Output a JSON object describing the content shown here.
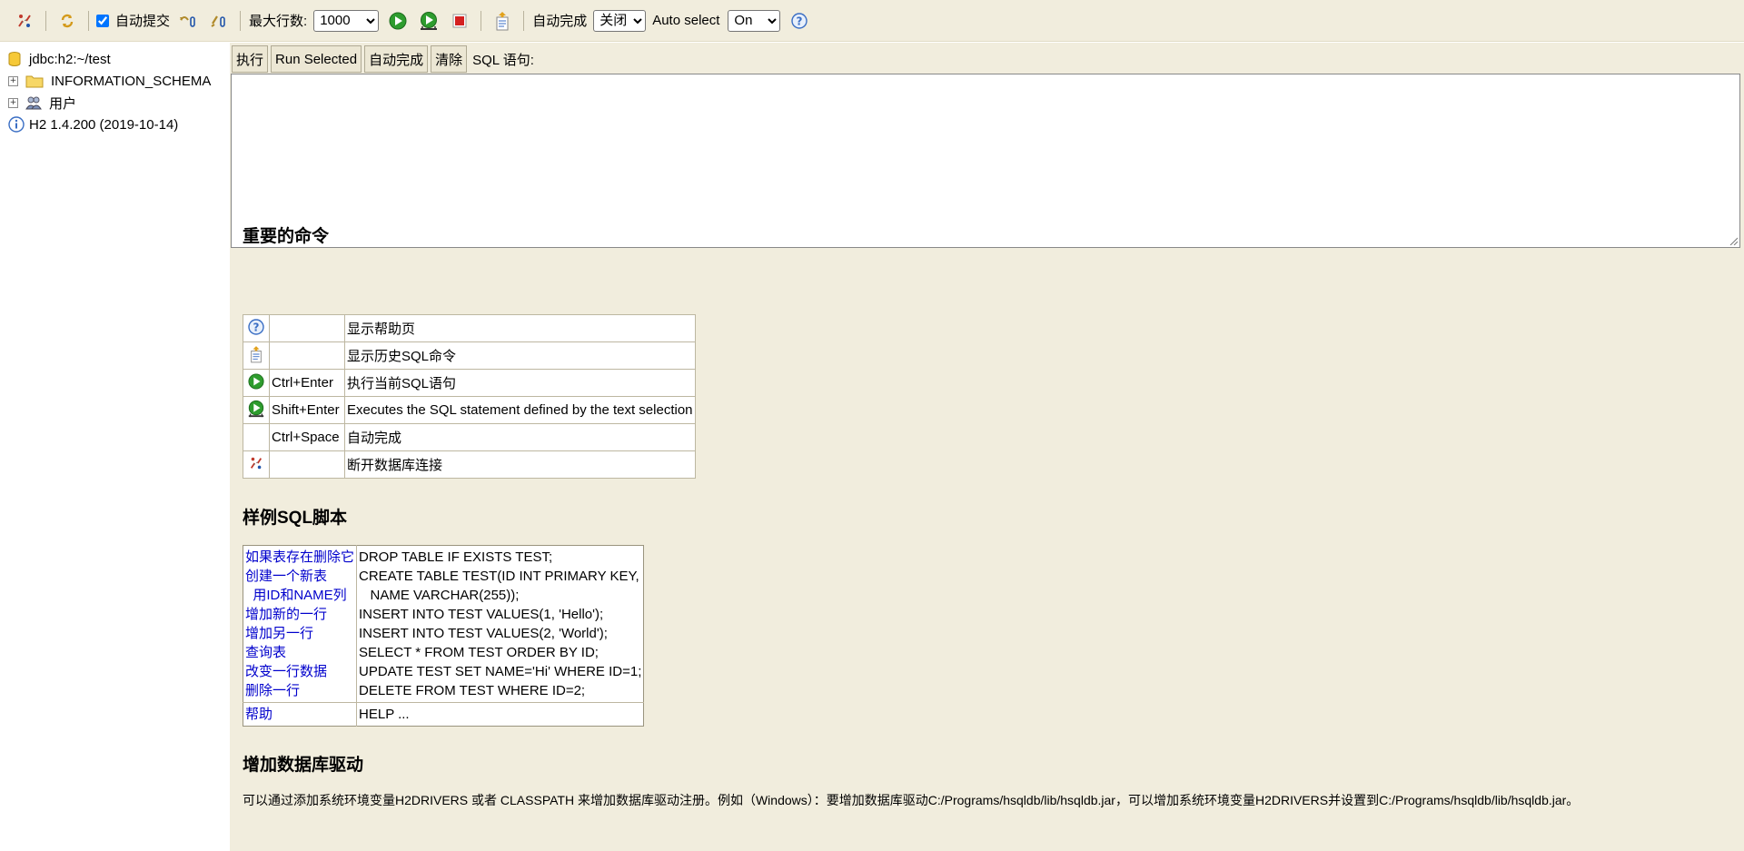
{
  "toolbar": {
    "autocommit_label": "自动提交",
    "autocommit_checked": true,
    "max_rows_label": "最大行数:",
    "max_rows_value": "1000",
    "autocomplete_label": "自动完成",
    "autocomplete_value": "关闭",
    "autoselect_label": "Auto select",
    "autoselect_value": "On",
    "icons": [
      "disconnect-icon",
      "refresh-icon",
      "rollback-icon",
      "commit-icon",
      "run-icon",
      "run-selected-icon",
      "stop-icon",
      "history-icon",
      "help-icon"
    ]
  },
  "tree": {
    "connection": "jdbc:h2:~/test",
    "schema": "INFORMATION_SCHEMA",
    "users": "用户",
    "version": "H2 1.4.200 (2019-10-14)",
    "expander_symbol": "+"
  },
  "editor": {
    "buttons": {
      "execute": "执行",
      "run_selected": "Run Selected",
      "autocomplete": "自动完成",
      "clear": "清除"
    },
    "sql_label": "SQL 语句:"
  },
  "important": {
    "title": "重要的命令",
    "rows": [
      {
        "icon": "help-icon",
        "key": "",
        "desc": "显示帮助页"
      },
      {
        "icon": "history-icon",
        "key": "",
        "desc": "显示历史SQL命令"
      },
      {
        "icon": "run-icon",
        "key": "Ctrl+Enter",
        "desc": "执行当前SQL语句"
      },
      {
        "icon": "run-selected-icon",
        "key": "Shift+Enter",
        "desc": "Executes the SQL statement defined by the text selection"
      },
      {
        "icon": "",
        "key": "Ctrl+Space",
        "desc": "自动完成"
      },
      {
        "icon": "disconnect-icon",
        "key": "",
        "desc": "断开数据库连接"
      }
    ]
  },
  "sample": {
    "title": "样例SQL脚本",
    "rows": [
      {
        "label": "如果表存在删除它",
        "sql": "DROP TABLE IF EXISTS TEST;"
      },
      {
        "label": "创建一个新表",
        "sql": "CREATE TABLE TEST(ID INT PRIMARY KEY,"
      },
      {
        "label": "  用ID和NAME列",
        "sql": "   NAME VARCHAR(255));"
      },
      {
        "label": "增加新的一行",
        "sql": "INSERT INTO TEST VALUES(1, 'Hello');"
      },
      {
        "label": "增加另一行",
        "sql": "INSERT INTO TEST VALUES(2, 'World');"
      },
      {
        "label": "查询表",
        "sql": "SELECT * FROM TEST ORDER BY ID;"
      },
      {
        "label": "改变一行数据",
        "sql": "UPDATE TEST SET NAME='Hi' WHERE ID=1;"
      },
      {
        "label": "删除一行",
        "sql": "DELETE FROM TEST WHERE ID=2;"
      }
    ],
    "help_label": "帮助",
    "help_sql": "HELP ..."
  },
  "drivers": {
    "title": "增加数据库驱动",
    "text": "可以通过添加系统环境变量H2DRIVERS 或者 CLASSPATH 来增加数据库驱动注册。例如（Windows）：要增加数据库驱动C:/Programs/hsqldb/lib/hsqldb.jar，可以增加系统环境变量H2DRIVERS并设置到C:/Programs/hsqldb/lib/hsqldb.jar。"
  },
  "colors": {
    "panel_bg": "#f1eddd",
    "link": "#0000cc",
    "run_green": "#2e9c2e",
    "stop_red": "#d42020"
  }
}
